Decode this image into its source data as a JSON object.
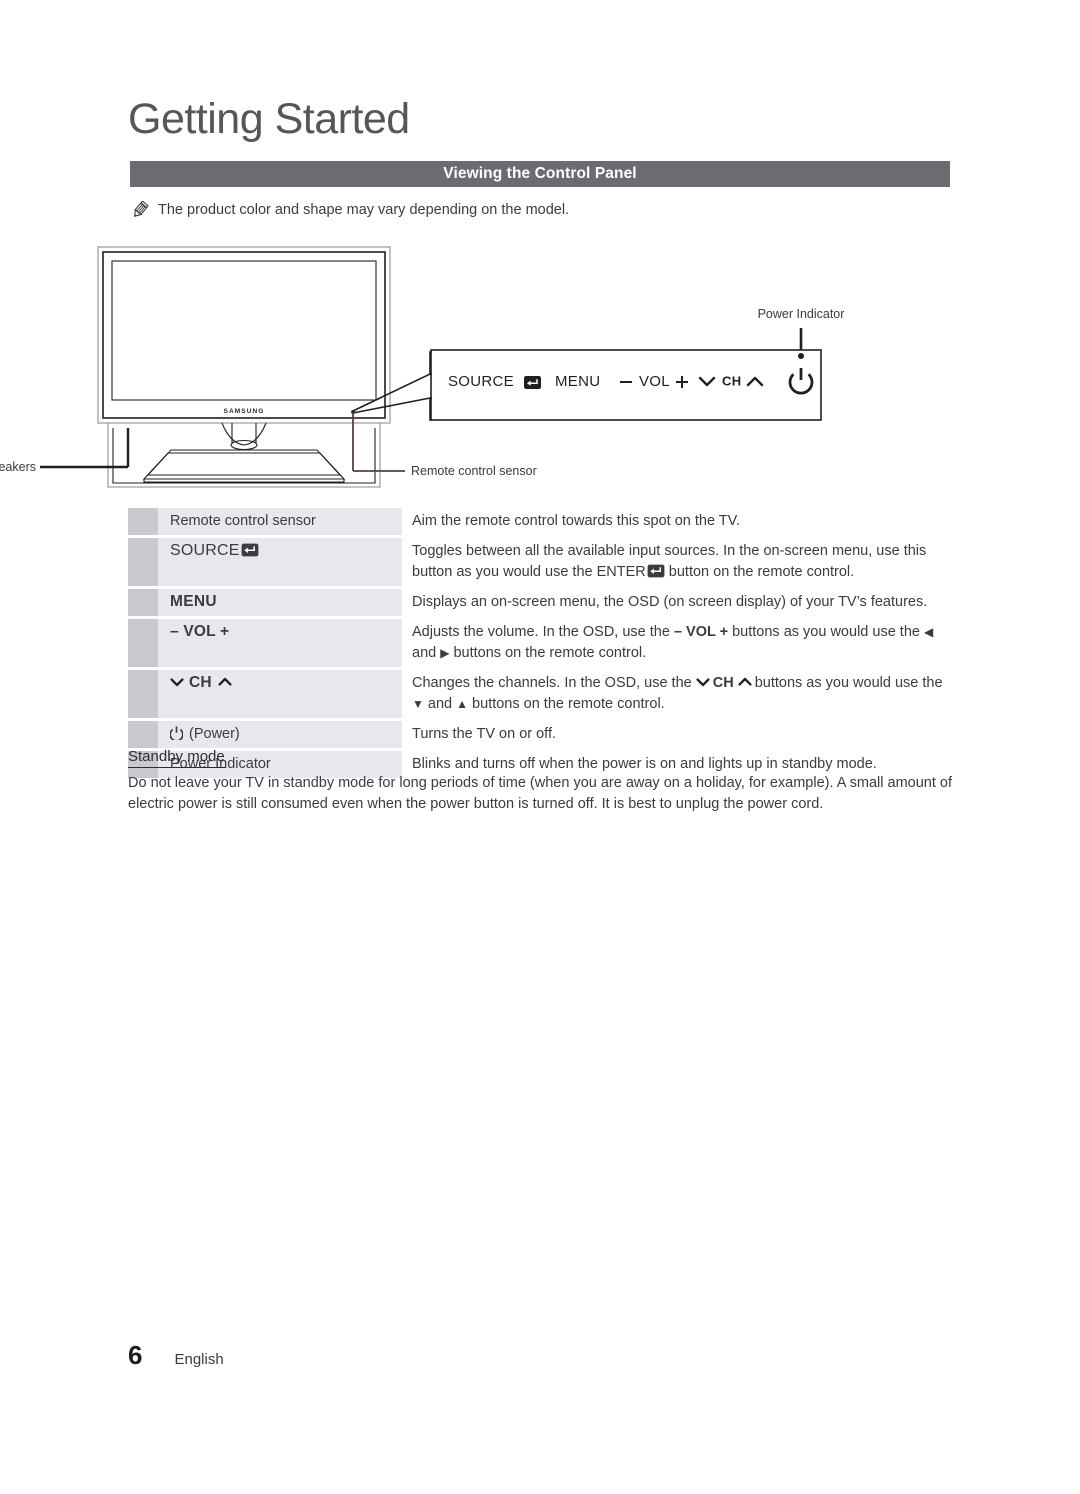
{
  "document": {
    "chapter_title": "Getting Started",
    "section_title": "Viewing the Control Panel",
    "note": "The product color and shape may vary depending on the model.",
    "note_icon": "pencil-icon"
  },
  "illustration": {
    "tv_brand": "SAMSUNG",
    "callouts": {
      "power_indicator": "Power Indicator",
      "speakers": "Speakers",
      "remote_control_sensor": "Remote control sensor"
    },
    "control_panel": {
      "source_label": "SOURCE",
      "source_icon": "enter-return-icon",
      "menu_label": "MENU",
      "vol_minus": "–",
      "vol_label": "VOL",
      "vol_plus": "+",
      "ch_down_icon": "chevron-down-icon",
      "ch_label": "CH",
      "ch_up_icon": "chevron-up-icon",
      "power_icon": "power-icon",
      "indicator_dot": "power-indicator-dot"
    }
  },
  "table": {
    "rows": [
      {
        "label": "Remote control sensor",
        "label_style": "plain",
        "icon": null,
        "description": "Aim the remote control towards this spot on the TV."
      },
      {
        "label": "SOURCE",
        "label_style": "source",
        "icon": "enter-return-icon",
        "description_parts": [
          "Toggles between all the available input sources. In the on-screen menu, use this button as you would use the ",
          "ENTER",
          " button on the remote control."
        ],
        "description_icon": "enter-return-icon"
      },
      {
        "label": "MENU",
        "label_style": "menu",
        "icon": null,
        "description": "Displays an on-screen menu, the OSD (on screen display) of your TV’s features."
      },
      {
        "label": "– VOL +",
        "label_style": "bold",
        "icon": null,
        "description_parts": [
          "Adjusts the volume. In the OSD, use the ",
          "– VOL +",
          " buttons as you would use the ",
          "◀",
          " and ",
          "▶",
          " buttons on the remote control."
        ]
      },
      {
        "label": "CH",
        "label_style": "ch",
        "icon": "chevron-pair-icon",
        "description_parts": [
          "Changes the channels. In the OSD, use the ",
          "CH",
          " buttons as you would use the ",
          "▼",
          " and ",
          "▲",
          " buttons on the remote control."
        ]
      },
      {
        "label": "(Power)",
        "label_style": "power",
        "icon": "power-icon",
        "description": "Turns the TV on or off."
      },
      {
        "label": "Power Indicator",
        "label_style": "plain",
        "icon": null,
        "description": "Blinks and turns off when the power is on and lights up in standby mode."
      }
    ]
  },
  "standby": {
    "heading": "Standby mode",
    "body": "Do not leave your TV in standby mode for long periods of time (when you are away on a holiday, for example). A small amount of electric power is still consumed even when the power button is turned off. It is best to unplug the power cord."
  },
  "footer": {
    "page_number": "6",
    "language": "English"
  },
  "colors": {
    "section_bar": "#6b6c71",
    "table_marker": "#c9cace",
    "table_label": "#e7e8ec",
    "text": "#3b3b40",
    "title": "#55555a"
  }
}
